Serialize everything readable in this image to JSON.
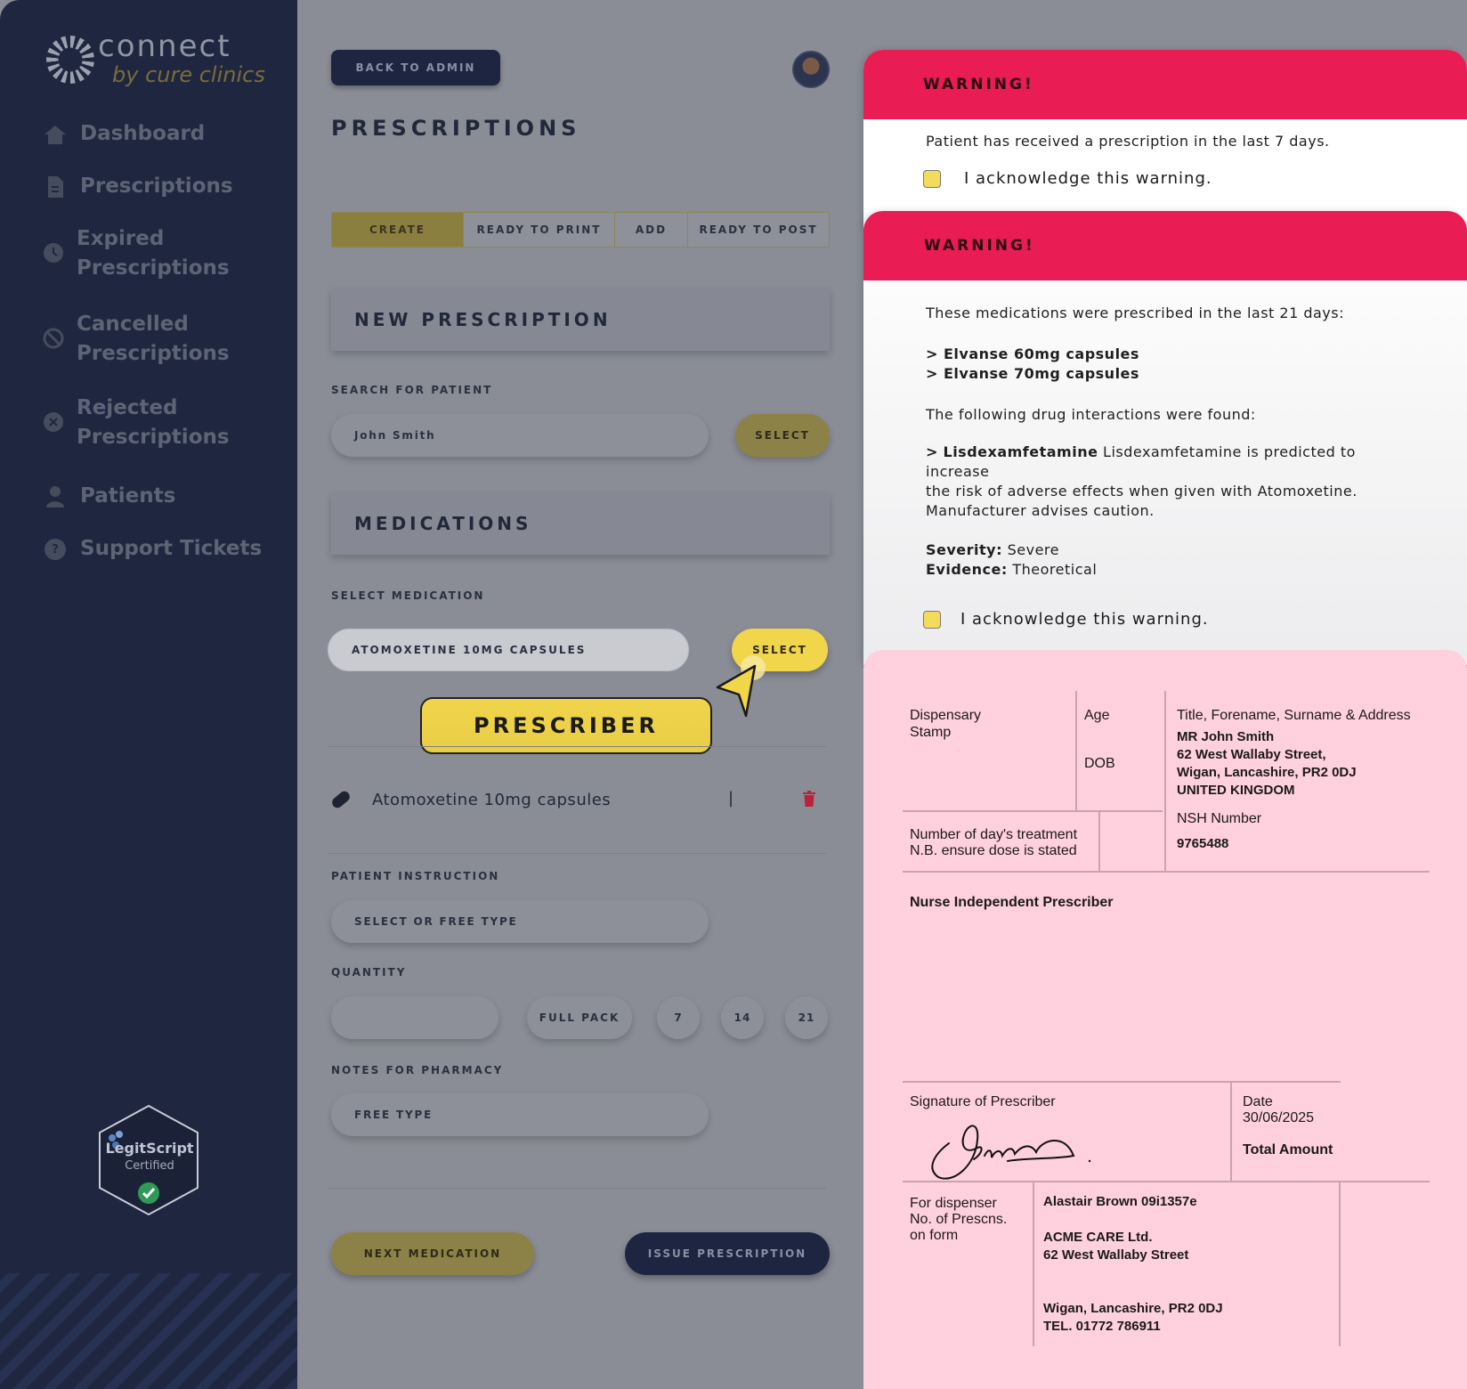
{
  "sidebar": {
    "logo": {
      "name": "connect",
      "sub": "by cure clinics"
    },
    "items": [
      {
        "label": "Dashboard",
        "icon": "home-icon"
      },
      {
        "label": "Prescriptions",
        "icon": "document-icon"
      },
      {
        "label": "Expired Prescriptions",
        "icon": "clock-icon"
      },
      {
        "label": "Cancelled Prescriptions",
        "icon": "ban-icon"
      },
      {
        "label": "Rejected Prescriptions",
        "icon": "x-circle-icon"
      },
      {
        "label": "Patients",
        "icon": "person-icon"
      },
      {
        "label": "Support Tickets",
        "icon": "help-icon"
      }
    ],
    "badge": {
      "name": "LegitScript",
      "certified": "Certified"
    }
  },
  "main": {
    "back_label": "BACK TO ADMIN",
    "title": "PRESCRIPTIONS",
    "tabs": [
      {
        "label": "CREATE",
        "active": true
      },
      {
        "label": "READY TO PRINT",
        "active": false
      },
      {
        "label": "ADD",
        "active": false
      },
      {
        "label": "READY TO POST",
        "active": false
      }
    ],
    "new_prescription": "NEW PRESCRIPTION",
    "search_label": "SEARCH FOR PATIENT",
    "search_value": "John Smith",
    "select_label": "SELECT",
    "medications_title": "MEDICATIONS",
    "select_medication_label": "SELECT MEDICATION",
    "medication_value": "ATOMOXETINE 10MG CAPSULES",
    "prescriber_label": "PRESCRIBER",
    "selected_medication": "Atomoxetine 10mg capsules",
    "separator": "|",
    "patient_instruction_label": "PATIENT INSTRUCTION",
    "patient_instruction_placeholder": "SELECT OR FREE TYPE",
    "quantity_label": "QUANTITY",
    "quantity_options": [
      "FULL PACK",
      "7",
      "14",
      "21"
    ],
    "notes_label": "NOTES FOR PHARMACY",
    "notes_placeholder": "FREE TYPE",
    "next_label": "NEXT MEDICATION",
    "issue_label": "ISSUE PRESCRIPTION"
  },
  "warning1": {
    "title": "WARNING!",
    "message": "Patient has received a prescription in the last 7 days.",
    "ack": "I acknowledge this warning."
  },
  "warning2": {
    "title": "WARNING!",
    "intro": "These medications were prescribed in the last 21 days:",
    "meds": [
      "> Elvanse 60mg capsules",
      "> Elvanse 70mg capsules"
    ],
    "interactions_intro": "The following drug interactions were found:",
    "interaction_prefix": ">",
    "interaction_drug": "Lisdexamfetamine",
    "interaction_text_1": "Lisdexamfetamine is predicted to increase",
    "interaction_text_2": "the risk of adverse effects when given with Atomoxetine.",
    "interaction_text_3": "Manufacturer advises caution.",
    "severity_label": "Severity:",
    "severity_value": "Severe",
    "evidence_label": "Evidence:",
    "evidence_value": "Theoretical",
    "ack": "I acknowledge this warning."
  },
  "form": {
    "dispensary_1": "Dispensary",
    "dispensary_2": "Stamp",
    "age": "Age",
    "dob": "DOB",
    "address_label": "Title, Forename, Surname & Address",
    "address": [
      "MR John Smith",
      "62 West Wallaby Street,",
      "Wigan, Lancashire, PR2 0DJ",
      "UNITED KINGDOM"
    ],
    "days_1": "Number of day's treatment",
    "days_2": "N.B. ensure dose is stated",
    "nsh_label": "NSH Number",
    "nsh_value": "9765488",
    "prescriber_type": "Nurse Independent Prescriber",
    "signature_label": "Signature of Prescriber",
    "date_label": "Date",
    "date_value": "30/06/2025",
    "total_label": "Total Amount",
    "dispenser_1": "For dispenser",
    "dispenser_2": "No. of Prescns.",
    "dispenser_3": "on form",
    "prescriber_name": "Alastair Brown 09i1357e",
    "company": "ACME CARE Ltd.",
    "company_street": "62 West Wallaby Street",
    "company_city": "Wigan, Lancashire, PR2 0DJ",
    "company_tel": "TEL. 01772 786911"
  },
  "colors": {
    "sidebar": "#1f2740",
    "accent_yellow": "#f1d54a",
    "warning_red": "#ea1c54",
    "form_pink": "#ffd0dd"
  }
}
